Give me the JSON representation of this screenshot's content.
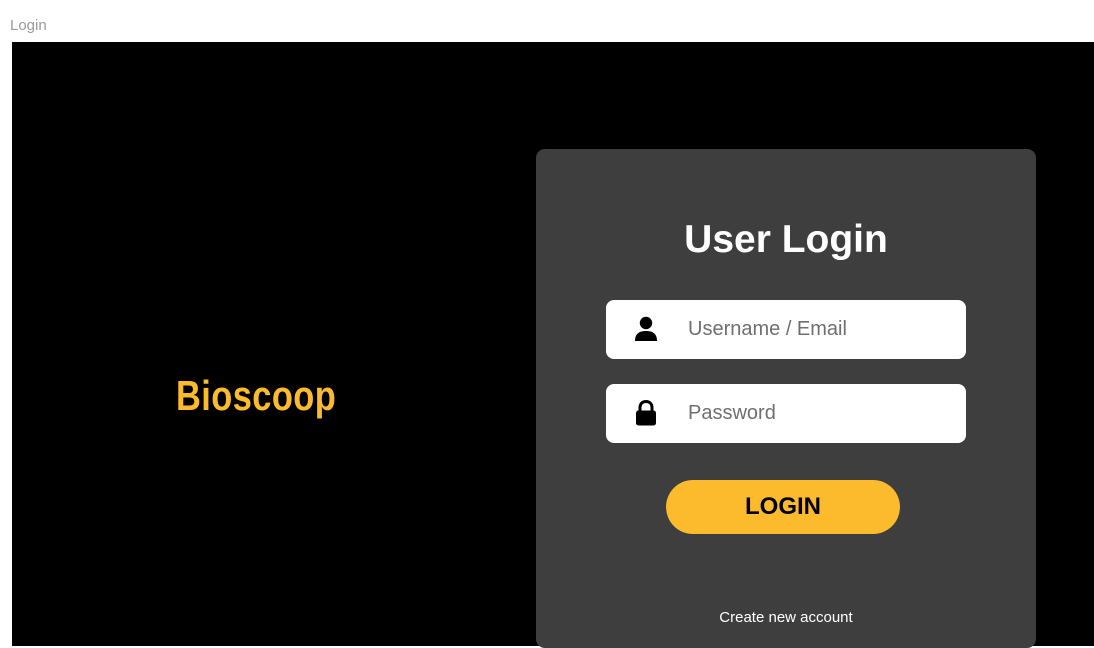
{
  "frame_label": "Login",
  "brand": {
    "name": "Bioscoop",
    "color": "#fbbb2c"
  },
  "login_card": {
    "title": "User Login",
    "username_field": {
      "placeholder": "Username / Email",
      "value": "",
      "icon": "user-icon"
    },
    "password_field": {
      "placeholder": "Password",
      "value": "",
      "icon": "lock-icon"
    },
    "login_button": "LOGIN",
    "create_account_link": "Create new account"
  },
  "colors": {
    "background": "#000000",
    "card": "#3e3e3e",
    "accent": "#fbbb2c"
  }
}
